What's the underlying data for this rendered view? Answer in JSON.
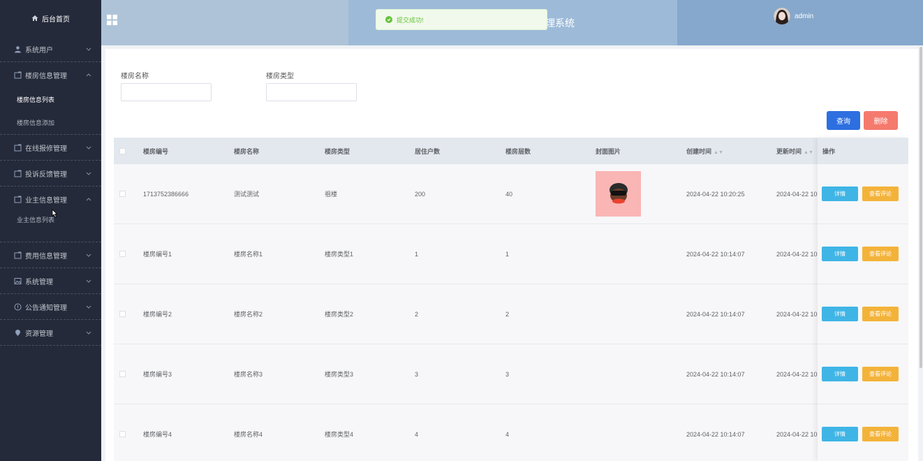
{
  "sidebar": {
    "home": "后台首页",
    "menus": [
      {
        "label": "系统用户",
        "expanded": false,
        "icon": "user-icon"
      },
      {
        "label": "楼房信息管理",
        "expanded": true,
        "icon": "folder-icon",
        "children": [
          "楼房信息列表",
          "楼房信息添加"
        ],
        "active_child": 0
      },
      {
        "label": "在线报修管理",
        "expanded": false,
        "icon": "folder-icon"
      },
      {
        "label": "投诉反馈管理",
        "expanded": false,
        "icon": "folder-icon"
      },
      {
        "label": "业主信息管理",
        "expanded": true,
        "icon": "folder-icon",
        "children": [
          "业主信息列表"
        ]
      },
      {
        "label": "费用信息管理",
        "expanded": false,
        "icon": "folder-icon"
      },
      {
        "label": "系统管理",
        "expanded": false,
        "icon": "image-icon"
      },
      {
        "label": "公告通知管理",
        "expanded": false,
        "icon": "info-icon"
      },
      {
        "label": "资源管理",
        "expanded": false,
        "icon": "pin-icon"
      }
    ]
  },
  "header": {
    "title": "理系统",
    "username": "admin"
  },
  "toast": {
    "message": "提交成功!"
  },
  "search": {
    "name_label": "楼房名称",
    "name_value": "",
    "type_label": "楼房类型",
    "type_value": "",
    "query_button": "查询",
    "delete_button": "删除"
  },
  "table": {
    "columns": [
      "楼房编号",
      "楼房名称",
      "楼房类型",
      "居住户数",
      "楼房层数",
      "封面图片",
      "创建时间",
      "更新时间",
      "操作"
    ],
    "rows": [
      {
        "id": "1713752386666",
        "name": "测试测试",
        "type": "祖楼",
        "households": "200",
        "floors": "40",
        "has_cover": true,
        "created": "2024-04-22 10:20:25",
        "updated": "2024-04-22 10"
      },
      {
        "id": "楼房编号1",
        "name": "楼房名称1",
        "type": "楼房类型1",
        "households": "1",
        "floors": "1",
        "has_cover": false,
        "created": "2024-04-22 10:14:07",
        "updated": "2024-04-22 10"
      },
      {
        "id": "楼房编号2",
        "name": "楼房名称2",
        "type": "楼房类型2",
        "households": "2",
        "floors": "2",
        "has_cover": false,
        "created": "2024-04-22 10:14:07",
        "updated": "2024-04-22 10"
      },
      {
        "id": "楼房编号3",
        "name": "楼房名称3",
        "type": "楼房类型3",
        "households": "3",
        "floors": "3",
        "has_cover": false,
        "created": "2024-04-22 10:14:07",
        "updated": "2024-04-22 10"
      },
      {
        "id": "楼房编号4",
        "name": "楼房名称4",
        "type": "楼房类型4",
        "households": "4",
        "floors": "4",
        "has_cover": false,
        "created": "2024-04-22 10:14:07",
        "updated": "2024-04-22 10"
      }
    ],
    "detail_button": "详情",
    "review_button": "查看评论"
  },
  "colors": {
    "sidebar_bg": "#252a3a",
    "query": "#2d6fe0",
    "delete": "#f57a6e",
    "detail": "#3fb5e6",
    "review": "#f3b33a",
    "success": "#67c23a"
  }
}
